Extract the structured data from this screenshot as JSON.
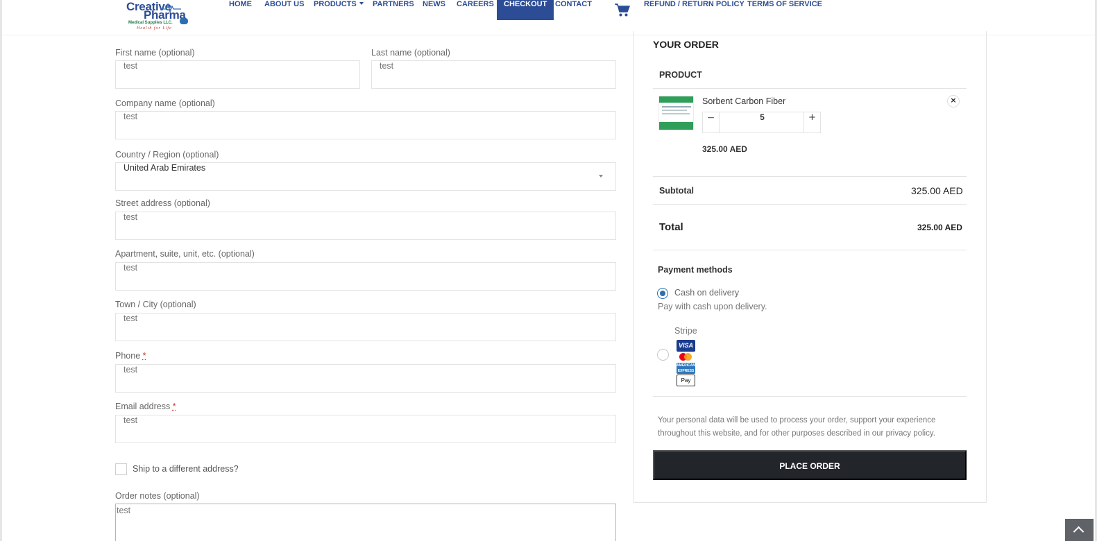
{
  "header": {
    "logo": {
      "line1": "Creative",
      "line2": "Pharma",
      "line3": "Medical Supplies LLC.",
      "tagline": "Health for Life"
    },
    "nav": [
      {
        "label": "HOME"
      },
      {
        "label": "ABOUT US"
      },
      {
        "label": "PRODUCTS"
      },
      {
        "label": "PARTNERS"
      },
      {
        "label": "NEWS"
      },
      {
        "label": "CAREERS"
      },
      {
        "label": "CHECKOUT",
        "active": true
      },
      {
        "label": "CONTACT"
      },
      {
        "label": "REFUND / RETURN POLICY"
      },
      {
        "label": "TERMS OF SERVICE"
      }
    ],
    "cart_icon": "shopping-cart-icon"
  },
  "billing": {
    "first_name": {
      "label": "First name (optional)",
      "value": "test"
    },
    "last_name": {
      "label": "Last name (optional)",
      "value": "test"
    },
    "company": {
      "label": "Company name (optional)",
      "value": "test"
    },
    "country": {
      "label": "Country / Region (optional)",
      "value": "United Arab Emirates"
    },
    "street": {
      "label": "Street address (optional)",
      "value": "test"
    },
    "apartment": {
      "label": "Apartment, suite, unit, etc. (optional)",
      "value": "test"
    },
    "city": {
      "label": "Town / City (optional)",
      "value": "test"
    },
    "phone": {
      "label": "Phone",
      "required_mark": "*",
      "value": "test"
    },
    "email": {
      "label": "Email address",
      "required_mark": "*",
      "value": "test"
    },
    "ship_different": {
      "label": "Ship to a different address?",
      "checked": false
    },
    "order_notes": {
      "label": "Order notes (optional)",
      "value": "test"
    }
  },
  "order": {
    "title": "YOUR ORDER",
    "product_header": "PRODUCT",
    "item": {
      "name": "Sorbent Carbon Fiber",
      "quantity": "5",
      "minus": "−",
      "plus": "+",
      "price": "325.00 AED",
      "remove": "×"
    },
    "subtotal_label": "Subtotal",
    "subtotal_value": "325.00 AED",
    "total_label": "Total",
    "total_value": "325.00 AED",
    "payment_title": "Payment methods",
    "payment": [
      {
        "label": "Cash on delivery",
        "description": "Pay with cash upon delivery.",
        "selected": true
      },
      {
        "label": "Stripe",
        "selected": false,
        "cards": [
          "VISA",
          "Mastercard",
          "AMERICAN EXPRESS",
          "Pay"
        ]
      }
    ],
    "privacy_line1": "Your personal data will be used to process your order, support your experience",
    "privacy_line2": "throughout this website, and for other purposes described in our privacy policy.",
    "place_order": "PLACE ORDER"
  },
  "colors": {
    "brand": "#2c4d95",
    "accent": "#2c6fb0",
    "button": "#22252a"
  }
}
